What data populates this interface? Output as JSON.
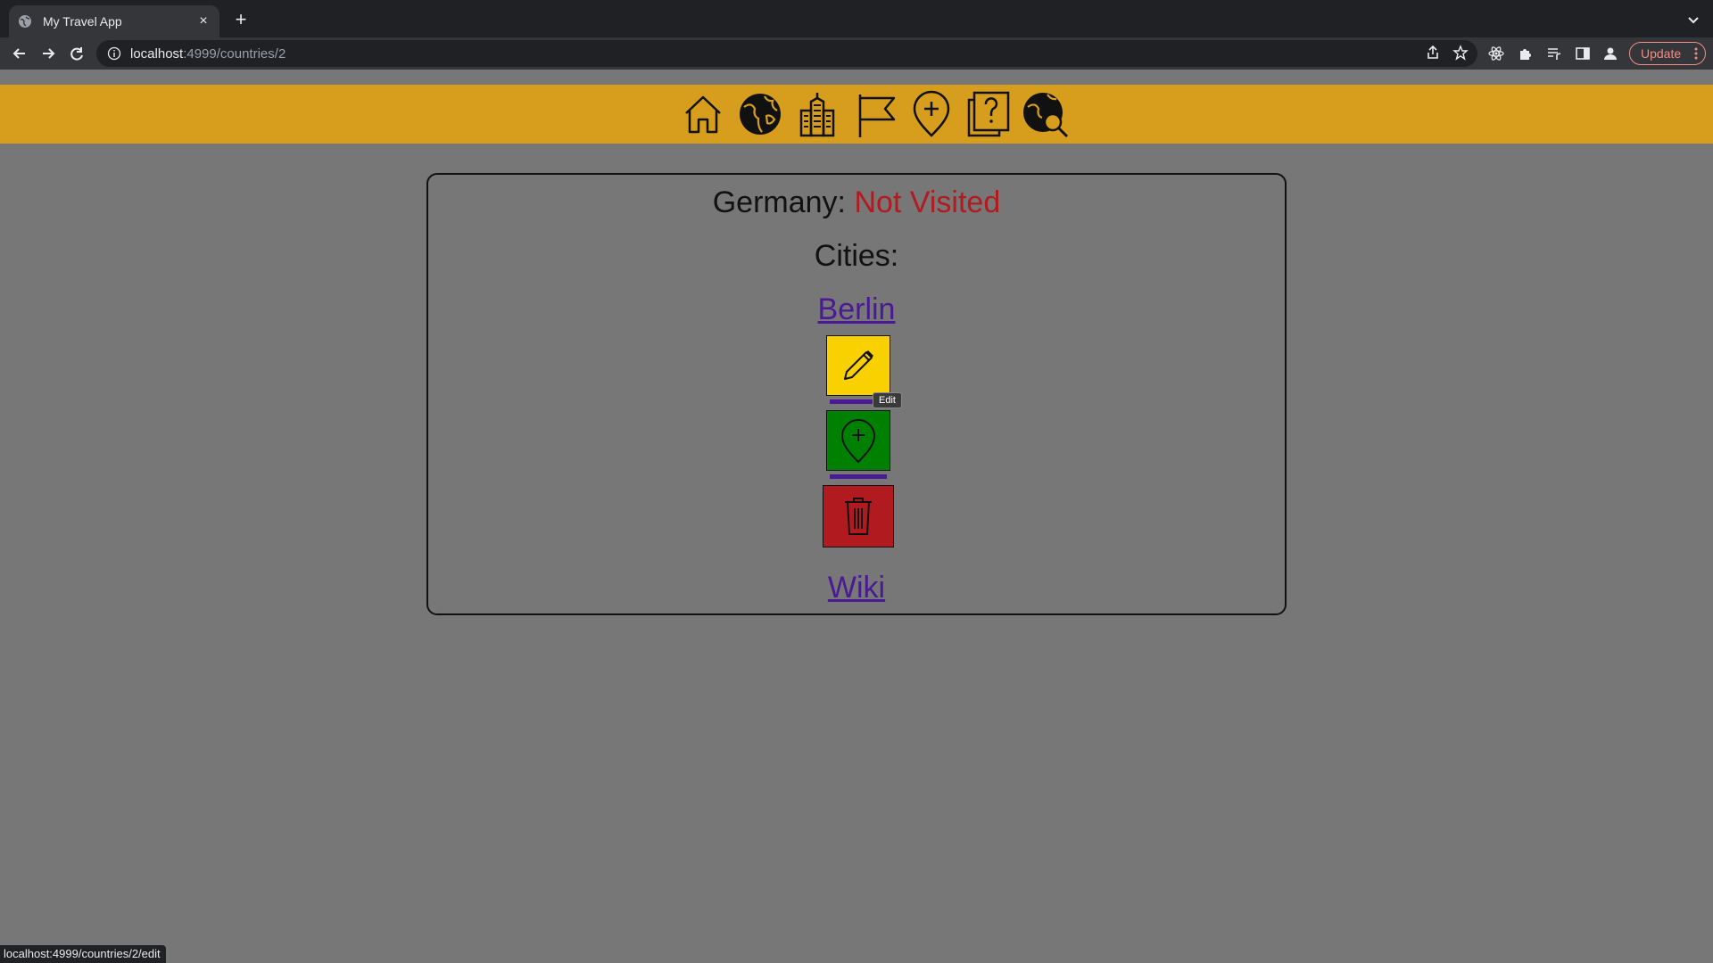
{
  "browser": {
    "tab_title": "My Travel App",
    "url_host": "localhost",
    "url_path": ":4999/countries/2",
    "update_label": "Update",
    "status_url": "localhost:4999/countries/2/edit"
  },
  "nav": {
    "icons": [
      "home-icon",
      "globe-icon",
      "city-icon",
      "flag-icon",
      "add-location-icon",
      "quiz-icon",
      "globe-search-icon"
    ]
  },
  "country": {
    "name": "Germany:",
    "status": "Not Visited",
    "status_color": "#b11b1f",
    "cities_label": "Cities:",
    "cities": [
      "Berlin"
    ],
    "edit_tooltip": "Edit",
    "wiki_label": "Wiki"
  },
  "colors": {
    "nav_bar": "#d69e1c",
    "page_bg": "#777777",
    "edit_button": "#f9d000",
    "add_trip_button": "#008000",
    "delete_button": "#b11b1f",
    "link": "#4a1a94"
  }
}
